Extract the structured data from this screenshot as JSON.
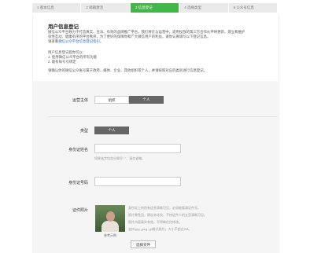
{
  "steps": [
    {
      "label": "1 基本信息",
      "active": false
    },
    {
      "label": "2 邮箱激活",
      "active": false
    },
    {
      "label": "3 信息登记",
      "active": true
    },
    {
      "label": "4 选择类型",
      "active": false
    },
    {
      "label": "5 公众号信息",
      "active": false
    }
  ],
  "intro": {
    "title": "用户信息登记",
    "para1_line1": "微信公众平台致力于打造真实、合法、有效的品牌推广平台，我们将在与运营中，适用投放的第三方合作伙伴将更新，建立和维护",
    "para1_line2": "良性互动、健康有序的平台秩序。为了更好的保障你和广大微信用户的利益，请你认真填写以下登记信息。",
    "para1_line3_prefix": "请查看",
    "para1_link": "微信公众平台信息登记指引。",
    "para2_line1": "用户信息登记后你可以：",
    "para2_line2": "1. 使用微信公众平台的所有功能",
    "para2_line3": "2. 能有每号号绑定",
    "para3": "请确认你的微信公众账号属于政府、媒体、企业、其他组织或个人，并请按照对应的类别进行信息登记。"
  },
  "form": {
    "subject_label": "运营主体",
    "subject_options": [
      "组织",
      "个人"
    ],
    "subject_selected": "个人",
    "type_label": "类型",
    "type_value": "个人",
    "id_name_label": "身份证姓名",
    "id_name_value": "",
    "id_name_hint": "如果名字包含分隔号\"·\"，请勿省略。",
    "id_number_label": "身份证号码",
    "id_number_value": "",
    "photo_label": "证件照片",
    "photo_caption": "参考示例",
    "photo_desc_1": "身份证上的所有信息清晰可见，必须能看清证件号。",
    "photo_desc_2": "照片需免冠，建议未化妆，手持证件人的五官清晰可见。",
    "photo_desc_3": "照片内容真实有效，不得做任何修改。",
    "photo_desc_4": "支持.jpg .jpeg .gif格式照片，大小不超过2M。",
    "upload_button": "选择文件"
  }
}
